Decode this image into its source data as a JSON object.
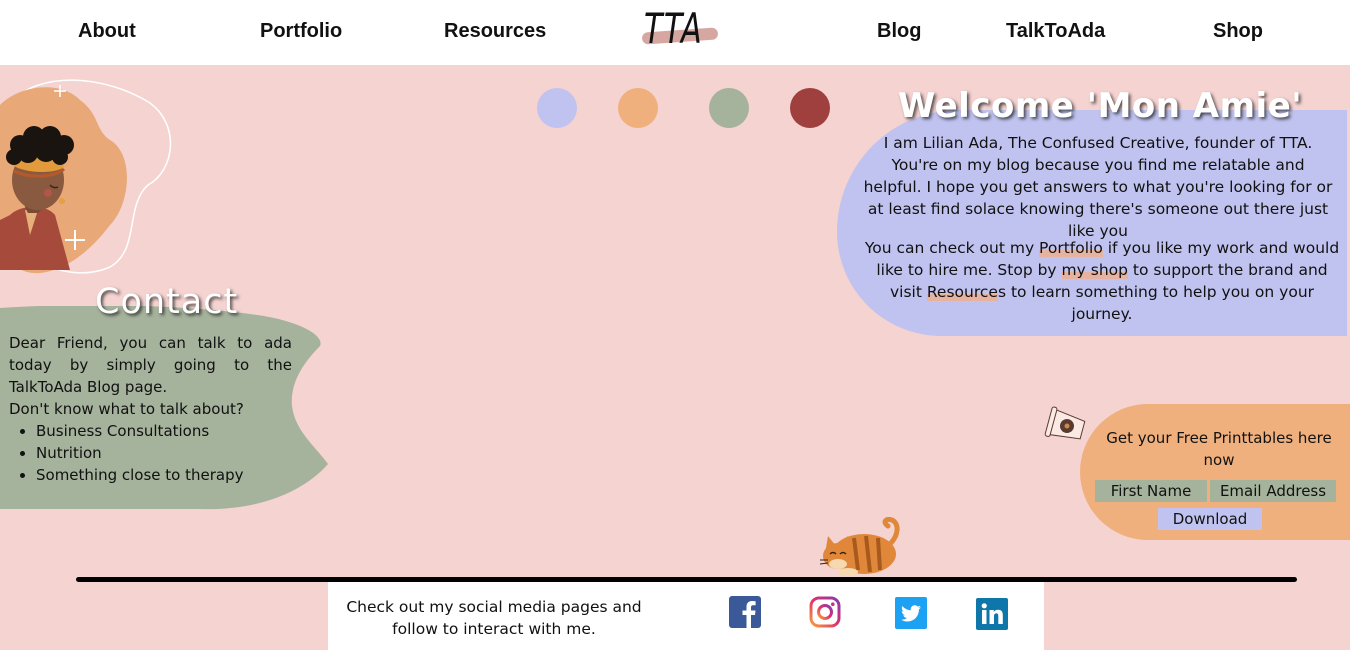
{
  "nav": {
    "about": "About",
    "portfolio": "Portfolio",
    "resources": "Resources",
    "logo_text": "TTA",
    "blog": "Blog",
    "talktoada": "TalkToAda",
    "shop": "Shop"
  },
  "palette": [
    "#c0c3ef",
    "#f0b07e",
    "#a5b29c",
    "#a0403e"
  ],
  "welcome": {
    "title": "Welcome 'Mon Amie'",
    "paragraph1": "I am Lilian Ada, The Confused Creative, founder of TTA. You're on my blog because you find me relatable and helpful. I hope you get answers to what you're looking for or at least find solace knowing there's someone out there just like you",
    "p2_text1": "You can check out my ",
    "p2_link_portfolio": "Portfolio",
    "p2_text2": " if you like my work and would like to hire me. Stop by ",
    "p2_link_shop": "my shop",
    "p2_text3": " to support the brand and visit ",
    "p2_link_resources": "Resource",
    "p2_text4": "s to learn something to help you on your journey."
  },
  "contact": {
    "title": "Contact",
    "intro": "Dear Friend, you can talk to ada today by simply going to the TalkToAda Blog page.",
    "question": "Don't know what to talk about?",
    "topics": [
      "Business Consultations",
      "Nutrition",
      "Something close to therapy"
    ]
  },
  "printables": {
    "title": "Get your Free Printtables here now",
    "first_name": "First Name",
    "email": "Email Address",
    "download": "Download"
  },
  "footer": {
    "text": "Check out my social media pages and follow to interact with me.",
    "socials": [
      "facebook-icon",
      "instagram-icon",
      "twitter-icon",
      "linkedin-icon"
    ]
  },
  "colors": {
    "background": "#f4d3d1",
    "lavender": "#c0c3ef",
    "peach": "#f0b07e",
    "sage": "#a5b29c",
    "maroon": "#a0403e"
  }
}
